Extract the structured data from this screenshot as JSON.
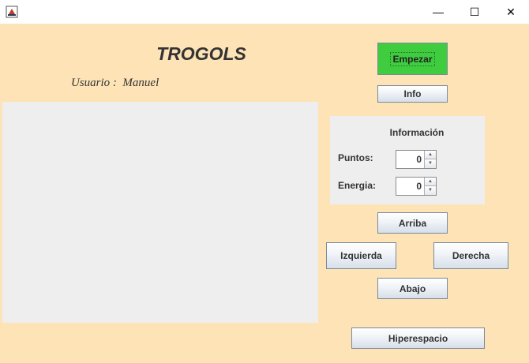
{
  "window": {
    "icon": "java-app-icon",
    "controls": {
      "minimize": "—",
      "maximize": "☐",
      "close": "✕"
    }
  },
  "header": {
    "title": "TROGOLS",
    "user_label": "Usuario :",
    "user_name": "Manuel"
  },
  "buttons": {
    "start": "Empezar",
    "info": "Info",
    "up": "Arriba",
    "left": "Izquierda",
    "right": "Derecha",
    "down": "Abajo",
    "hyperspace": "Hiperespacio"
  },
  "info_panel": {
    "title": "Información",
    "points_label": "Puntos:",
    "points_value": "0",
    "energy_label": "Energia:",
    "energy_value": "0"
  },
  "colors": {
    "background": "#fde3b6",
    "start_button": "#3fcd3f",
    "board": "#eeeeee"
  }
}
